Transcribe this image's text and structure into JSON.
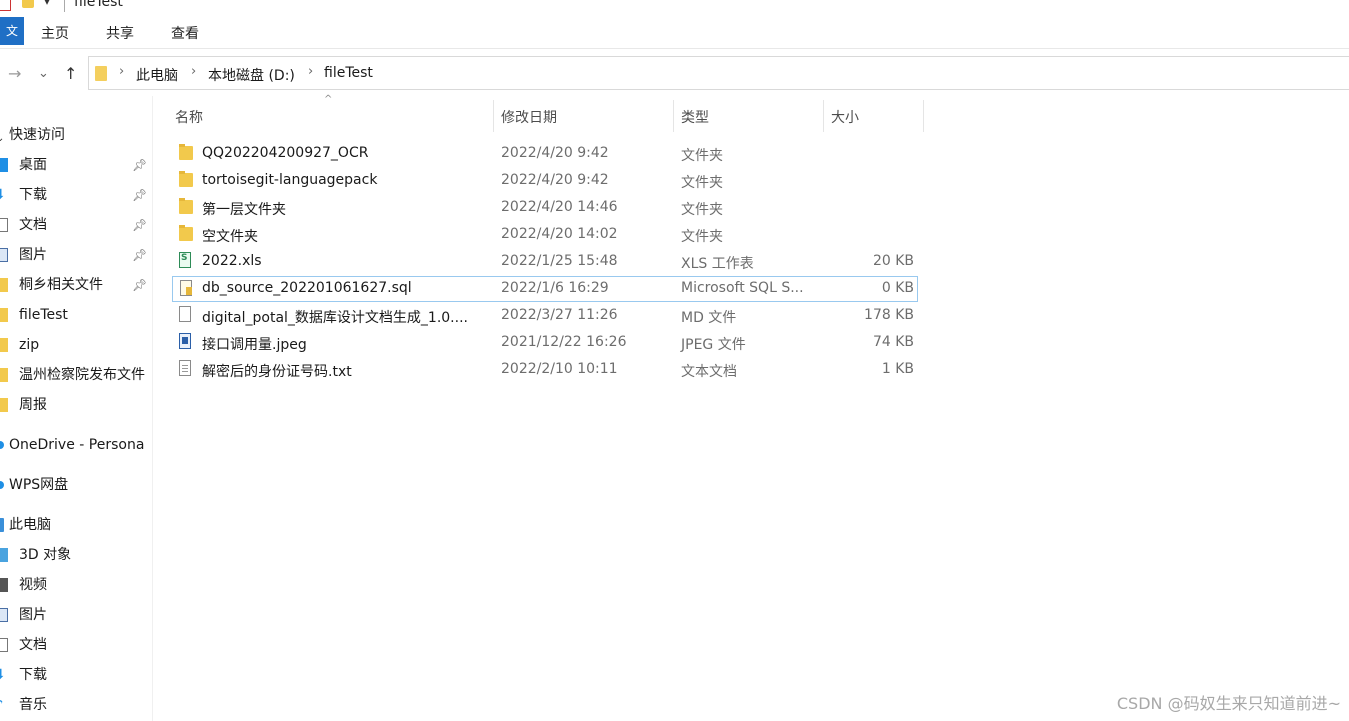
{
  "window": {
    "title": "fileTest"
  },
  "ribbon": {
    "file_tab": "文",
    "tabs": [
      "主页",
      "共享",
      "查看"
    ]
  },
  "address": {
    "crumbs": [
      "此电脑",
      "本地磁盘 (D:)",
      "fileTest"
    ]
  },
  "sidebar": {
    "quick_access": "快速访问",
    "items": [
      {
        "label": "桌面",
        "icon": "desktop-icon",
        "pinned": true
      },
      {
        "label": "下载",
        "icon": "download-icon",
        "pinned": true
      },
      {
        "label": "文档",
        "icon": "document-icon",
        "pinned": true
      },
      {
        "label": "图片",
        "icon": "picture-icon",
        "pinned": true
      },
      {
        "label": "桐乡相关文件",
        "icon": "folder-icon",
        "pinned": true
      },
      {
        "label": "fileTest",
        "icon": "folder-icon",
        "pinned": false
      },
      {
        "label": "zip",
        "icon": "folder-icon",
        "pinned": false
      },
      {
        "label": "温州检察院发布文件",
        "icon": "folder-icon",
        "pinned": false
      },
      {
        "label": "周报",
        "icon": "folder-icon",
        "pinned": false
      }
    ],
    "onedrive": "OneDrive - Persona",
    "wps": "WPS网盘",
    "this_pc": "此电脑",
    "pc_items": [
      {
        "label": "3D 对象",
        "icon": "cube-icon"
      },
      {
        "label": "视频",
        "icon": "video-icon"
      },
      {
        "label": "图片",
        "icon": "picture-icon"
      },
      {
        "label": "文档",
        "icon": "document-icon"
      },
      {
        "label": "下载",
        "icon": "download-icon"
      },
      {
        "label": "音乐",
        "icon": "music-icon"
      }
    ]
  },
  "columns": {
    "name": "名称",
    "date": "修改日期",
    "type": "类型",
    "size": "大小"
  },
  "files": [
    {
      "name": "QQ202204200927_OCR",
      "date": "2022/4/20 9:42",
      "type": "文件夹",
      "size": "",
      "icon": "folder-icon"
    },
    {
      "name": "tortoisegit-languagepack",
      "date": "2022/4/20 9:42",
      "type": "文件夹",
      "size": "",
      "icon": "folder-icon"
    },
    {
      "name": "第一层文件夹",
      "date": "2022/4/20 14:46",
      "type": "文件夹",
      "size": "",
      "icon": "folder-icon"
    },
    {
      "name": "空文件夹",
      "date": "2022/4/20 14:02",
      "type": "文件夹",
      "size": "",
      "icon": "folder-icon"
    },
    {
      "name": "2022.xls",
      "date": "2022/1/25 15:48",
      "type": "XLS 工作表",
      "size": "20 KB",
      "icon": "xls-file-icon"
    },
    {
      "name": "db_source_202201061627.sql",
      "date": "2022/1/6 16:29",
      "type": "Microsoft SQL S...",
      "size": "0 KB",
      "icon": "sql-file-icon",
      "selected": true
    },
    {
      "name": "digital_potal_数据库设计文档生成_1.0....",
      "date": "2022/3/27 11:26",
      "type": "MD 文件",
      "size": "178 KB",
      "icon": "md-file-icon"
    },
    {
      "name": "接口调用量.jpeg",
      "date": "2021/12/22 16:26",
      "type": "JPEG 文件",
      "size": "74 KB",
      "icon": "jpeg-file-icon"
    },
    {
      "name": "解密后的身份证号码.txt",
      "date": "2022/2/10 10:11",
      "type": "文本文档",
      "size": "1 KB",
      "icon": "txt-file-icon"
    }
  ],
  "watermark": "CSDN @码奴生来只知道前进~"
}
